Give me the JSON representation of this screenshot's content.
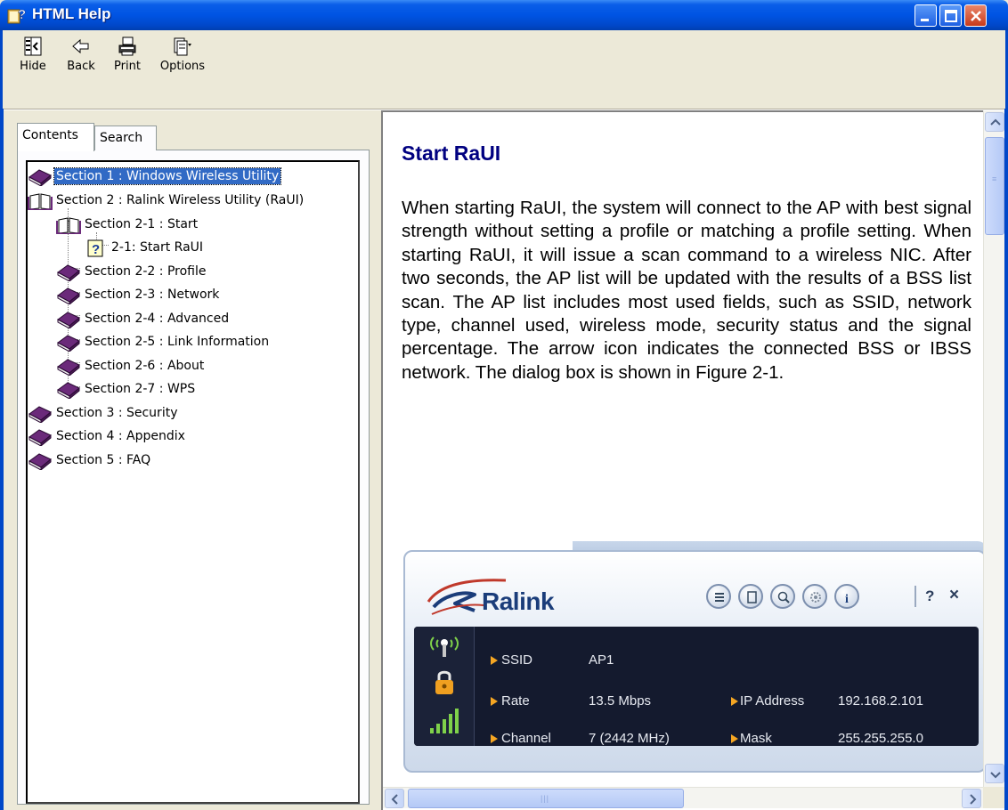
{
  "window": {
    "title": "HTML Help",
    "controls": [
      "minimize",
      "maximize",
      "close"
    ]
  },
  "toolbar": {
    "buttons": [
      {
        "label": "Hide",
        "icon": "hide-icon"
      },
      {
        "label": "Back",
        "icon": "back-arrow-icon"
      },
      {
        "label": "Print",
        "icon": "printer-icon"
      },
      {
        "label": "Options",
        "icon": "options-icon"
      }
    ]
  },
  "nav": {
    "tabs": [
      {
        "label": "Contents",
        "active": true
      },
      {
        "label": "Search",
        "active": false
      }
    ],
    "tree": [
      {
        "label": "Section 1 : Windows Wireless Utility",
        "icon": "closed-book-icon",
        "selected": true
      },
      {
        "label": "Section 2 : Ralink Wireless Utility (RaUI)",
        "icon": "open-book-icon"
      },
      {
        "label": "Section 2-1 : Start",
        "icon": "open-book-icon"
      },
      {
        "label": "2-1: Start RaUI",
        "icon": "help-page-icon"
      },
      {
        "label": "Section 2-2 : Profile",
        "icon": "closed-book-icon"
      },
      {
        "label": "Section 2-3 : Network",
        "icon": "closed-book-icon"
      },
      {
        "label": "Section 2-4 : Advanced",
        "icon": "closed-book-icon"
      },
      {
        "label": "Section 2-5 : Link Information",
        "icon": "closed-book-icon"
      },
      {
        "label": "Section 2-6 : About",
        "icon": "closed-book-icon"
      },
      {
        "label": "Section 2-7 : WPS",
        "icon": "closed-book-icon"
      },
      {
        "label": "Section 3 : Security",
        "icon": "closed-book-icon"
      },
      {
        "label": "Section 4 : Appendix",
        "icon": "closed-book-icon"
      },
      {
        "label": "Section 5 : FAQ",
        "icon": "closed-book-icon"
      }
    ]
  },
  "article": {
    "title": "Start RaUI",
    "body": "When starting RaUI, the system will connect to the AP with best signal strength without setting a profile or matching a profile setting. When starting RaUI, it will issue a scan command to a wireless NIC. After two seconds, the AP list will be updated with the results of a BSS list scan. The AP list includes most used fields, such as SSID, network type, channel used, wireless mode, security status and the signal percentage. The arrow icon indicates the connected BSS or IBSS network. The dialog box is shown in Figure 2-1."
  },
  "figure": {
    "brand": "Ralink",
    "title_buttons": [
      "?",
      "×"
    ],
    "fields": [
      {
        "key": "SSID",
        "value": "AP1"
      },
      {
        "key": "Rate",
        "value": "13.5 Mbps"
      },
      {
        "key": "Channel",
        "value": "7 (2442 MHz)"
      },
      {
        "key": "IP Address",
        "value": "192.168.2.101"
      },
      {
        "key": "Mask",
        "value": "255.255.255.0"
      }
    ]
  },
  "colors": {
    "titlebar": "#0054e3",
    "selection": "#316ac5",
    "heading": "#000080",
    "accent_arrow": "#f5a623"
  }
}
